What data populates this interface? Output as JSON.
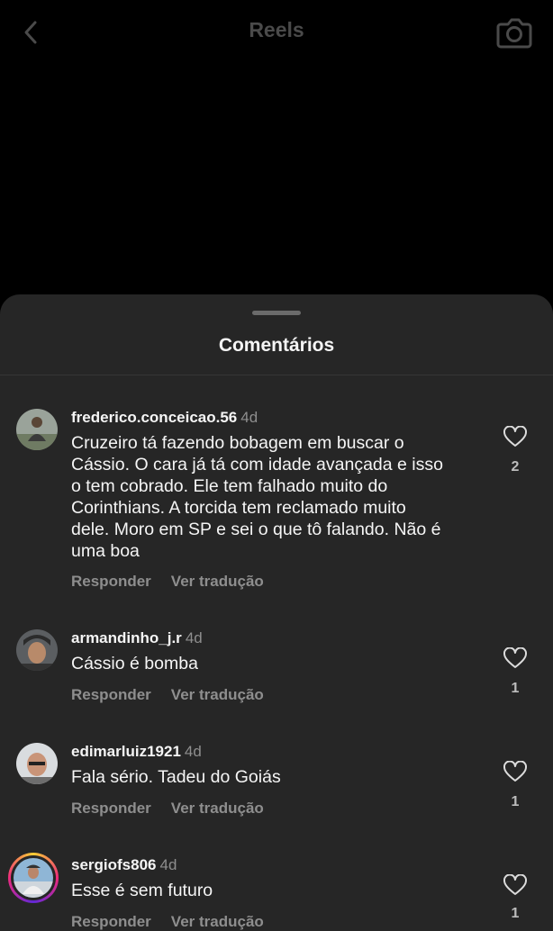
{
  "header": {
    "title": "Reels",
    "back_icon": "chevron-left-icon",
    "camera_icon": "camera-icon"
  },
  "comments_sheet": {
    "title": "Comentários",
    "comments": [
      {
        "username": "frederico.conceicao.56",
        "time": "4d",
        "text": "Cruzeiro tá fazendo bobagem em buscar o\nCássio. O cara já tá com idade avançada e isso\no tem cobrado. Ele tem falhado muito do\nCorinthians. A torcida tem reclamado muito\ndele. Moro em SP e sei o que tô falando. Não é\numa boa",
        "reply_label": "Responder",
        "translate_label": "Ver tradução",
        "likes": "2"
      },
      {
        "username": "armandinho_j.r",
        "time": "4d",
        "text": "Cássio é bomba",
        "reply_label": "Responder",
        "translate_label": "Ver tradução",
        "likes": "1"
      },
      {
        "username": "edimarluiz1921",
        "time": "4d",
        "text": "Fala sério. Tadeu do Goiás",
        "reply_label": "Responder",
        "translate_label": "Ver tradução",
        "likes": "1"
      },
      {
        "username": "sergiofs806",
        "time": "4d",
        "text": "Esse é sem futuro",
        "reply_label": "Responder",
        "translate_label": "Ver tradução",
        "likes": "1"
      }
    ]
  },
  "colors": {
    "background": "#000000",
    "sheet": "#262626",
    "muted_text": "#8e8e8e"
  }
}
